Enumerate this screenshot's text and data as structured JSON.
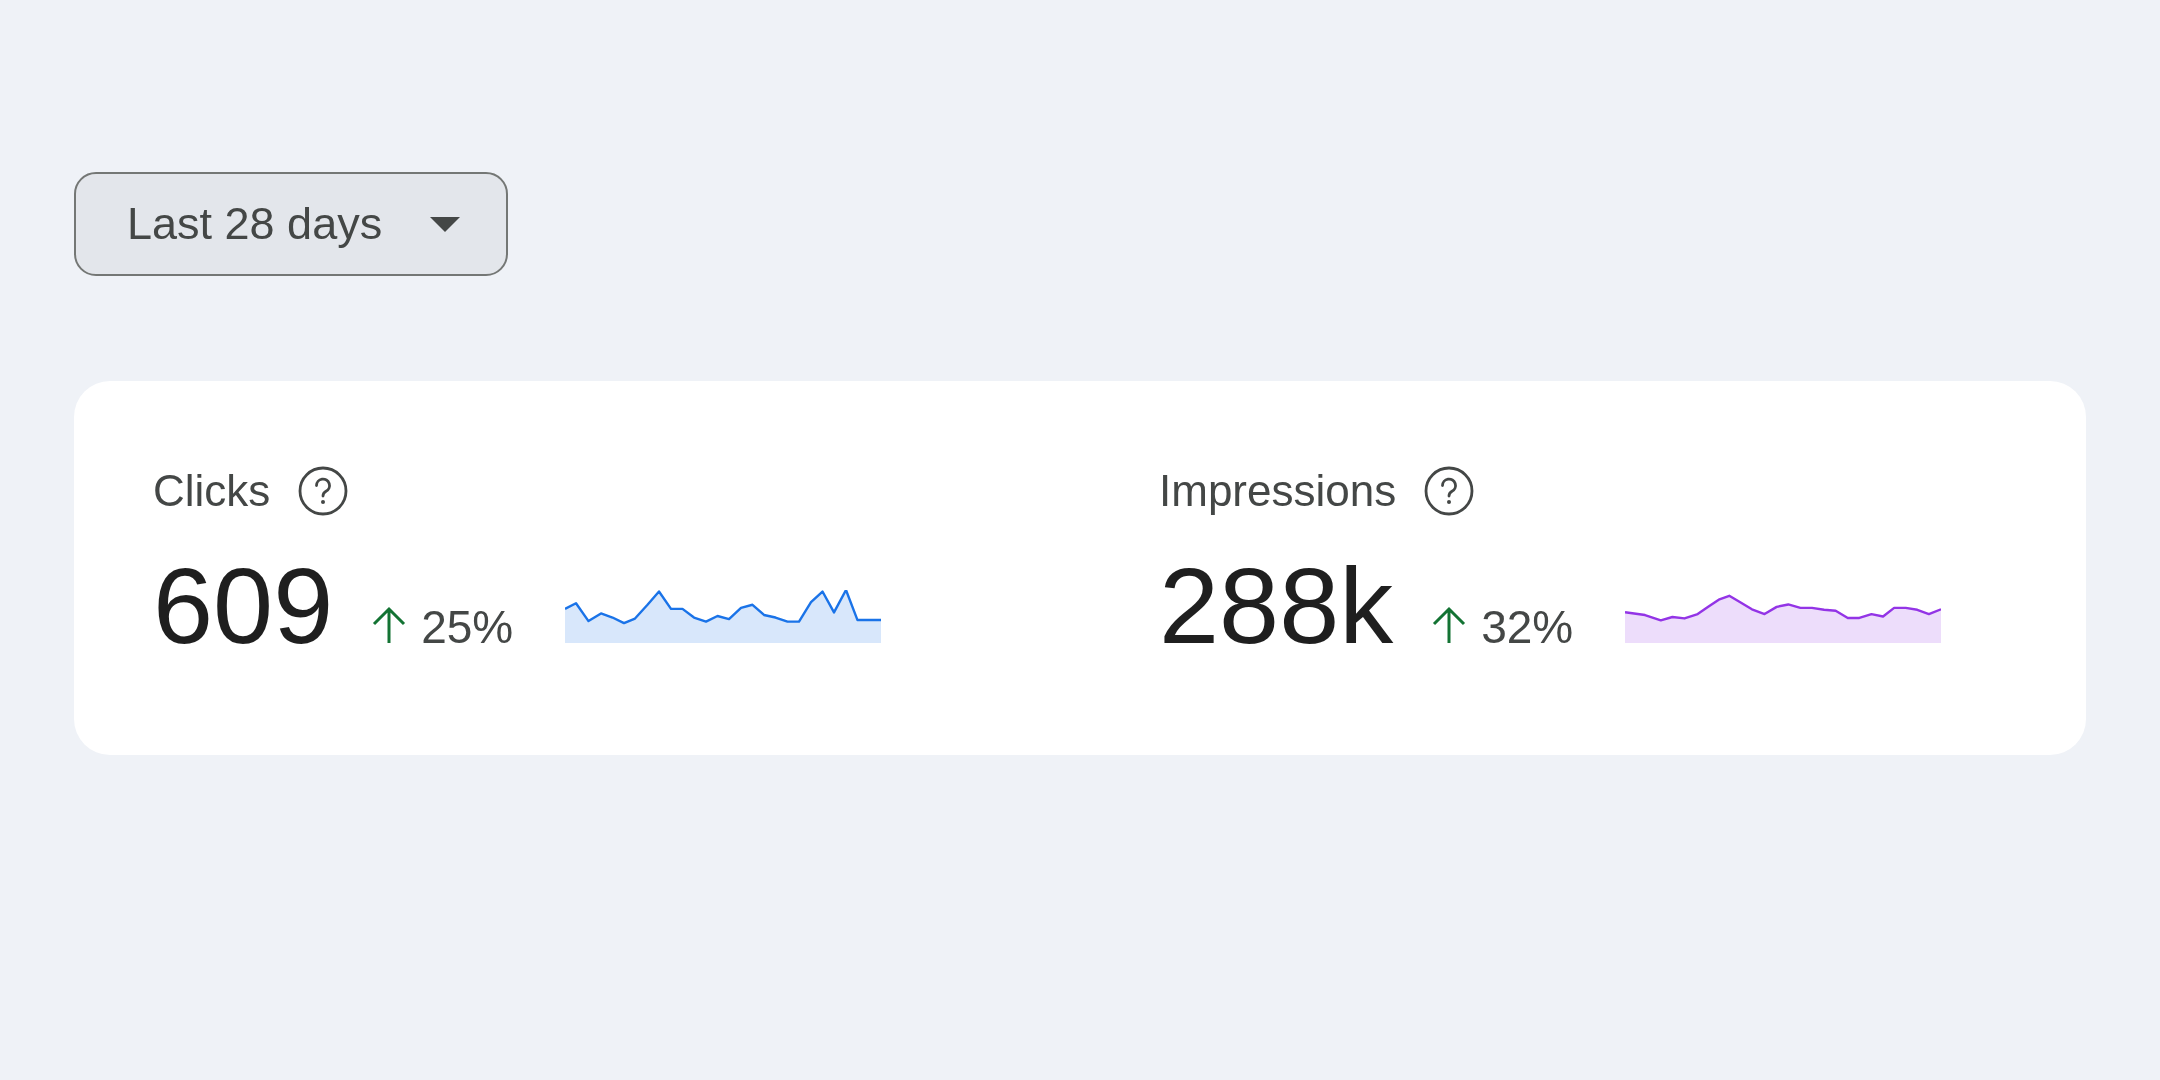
{
  "date_range": {
    "label": "Last 28 days"
  },
  "metrics": [
    {
      "label": "Clicks",
      "value": "609",
      "rising": true,
      "change": "25%",
      "color": "#1a73e8"
    },
    {
      "label": "Impressions",
      "value": "288k",
      "rising": true,
      "change": "32%",
      "color": "#9334e6"
    }
  ]
}
